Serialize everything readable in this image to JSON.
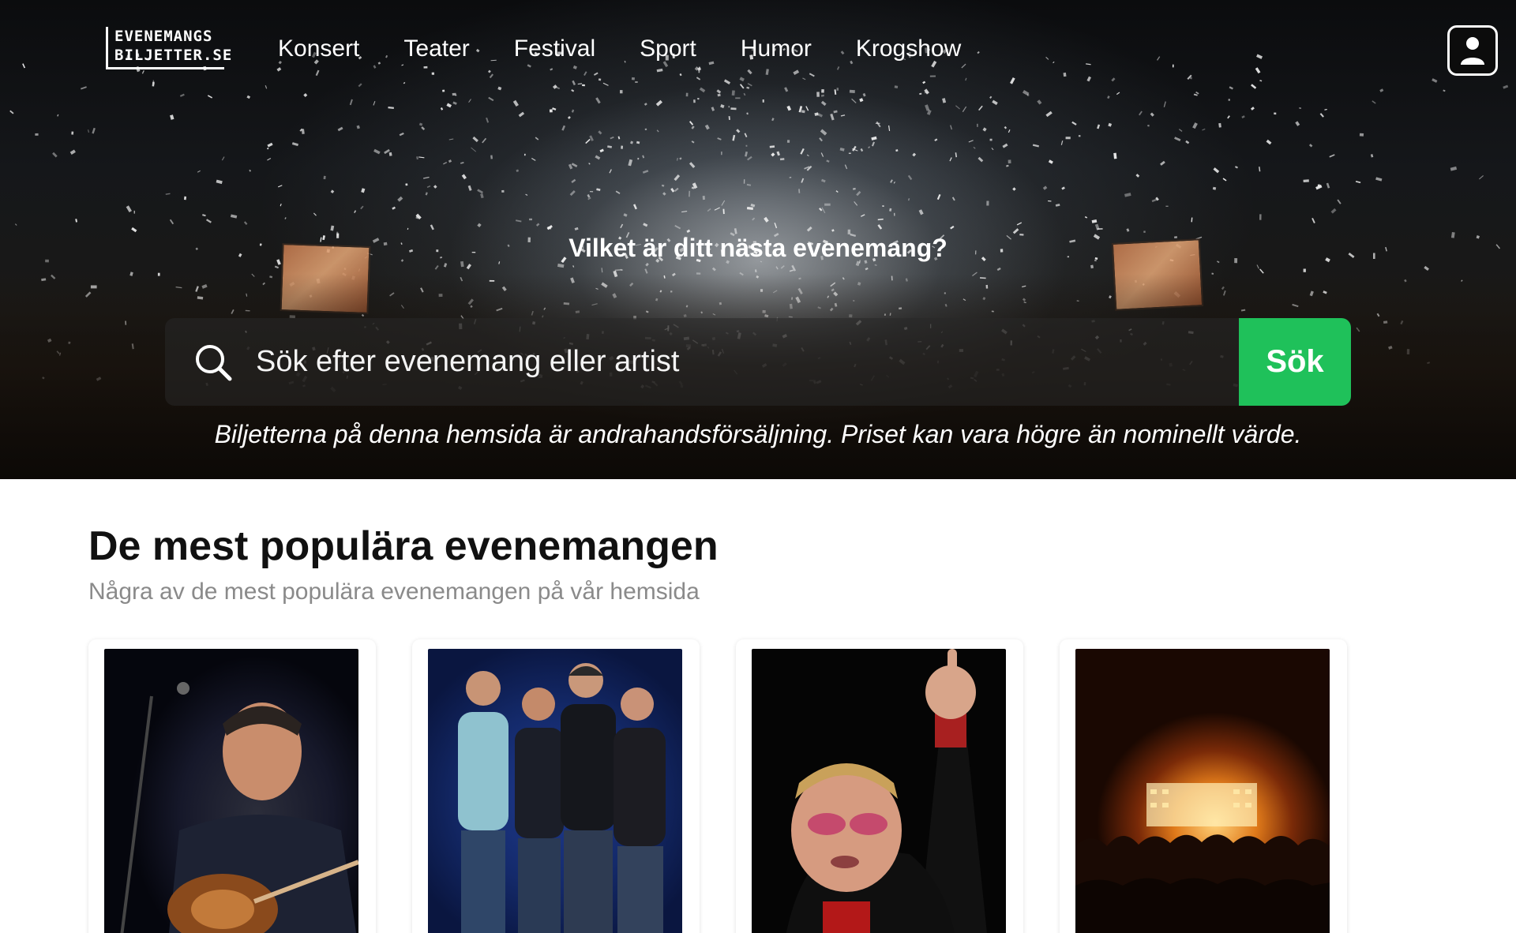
{
  "header": {
    "logo_line1": "EVENEMANGS",
    "logo_line2": "BILJETTER.SE",
    "nav": [
      "Konsert",
      "Teater",
      "Festival",
      "Sport",
      "Humor",
      "Krogshow"
    ],
    "user_icon": "user-icon"
  },
  "hero": {
    "title": "Vilket är ditt nästa evenemang?",
    "search_placeholder": "Sök efter evenemang eller artist",
    "search_button": "Sök",
    "disclaimer": "Biljetterna på denna hemsida är andrahandsförsäljning. Priset kan vara högre än nominellt värde."
  },
  "popular": {
    "title": "De mest populära evenemangen",
    "subtitle": "Några av de mest populära evenemangen på vår hemsida"
  },
  "colors": {
    "accent_green": "#1fc15a"
  }
}
